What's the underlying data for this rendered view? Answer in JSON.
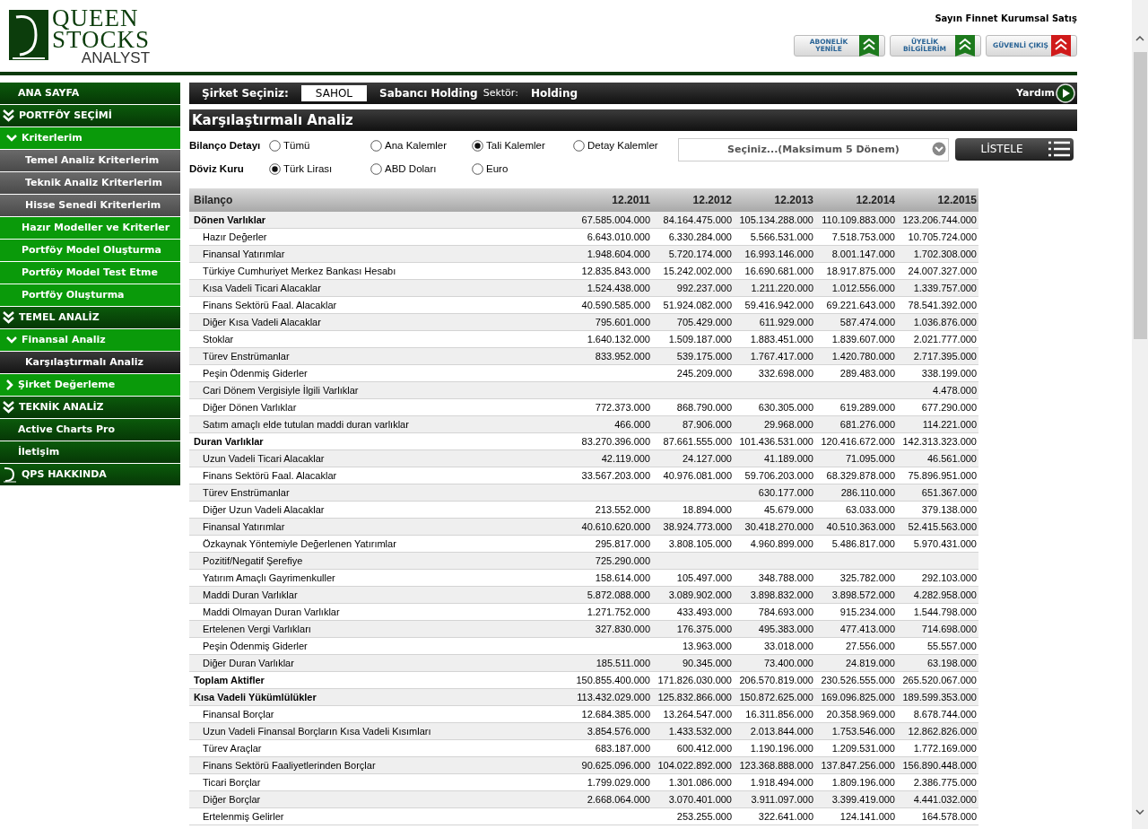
{
  "logo": {
    "lines": [
      "QUEEN",
      "STOCKS",
      "ANALYST"
    ]
  },
  "header": {
    "greeting": "Sayın Finnet Kurumsal Satış",
    "buttons": [
      {
        "label": "ABONELİK YENİLE",
        "kind": "green"
      },
      {
        "label": "ÜYELİK BİLGİLERİM",
        "kind": "green"
      },
      {
        "label": "GÜVENLİ ÇIKIŞ",
        "kind": "red"
      }
    ]
  },
  "sidebar": {
    "items": [
      {
        "label": "ANA SAYFA",
        "kind": "top",
        "selected": false
      },
      {
        "label": "PORTFÖY SEÇİMİ",
        "kind": "section",
        "expanded": true,
        "selected": false,
        "children": [
          {
            "label": "Kriterlerim",
            "kind": "group",
            "expanded": true,
            "selected": false,
            "children": [
              {
                "label": "Temel Analiz Kriterlerim",
                "kind": "leaf",
                "selected": false
              },
              {
                "label": "Teknik Analiz Kriterlerim",
                "kind": "leaf",
                "selected": false
              },
              {
                "label": "Hisse Senedi Kriterlerim",
                "kind": "leaf",
                "selected": false
              }
            ]
          },
          {
            "label": "Hazır Modeller ve Kriterler",
            "kind": "item",
            "selected": false
          },
          {
            "label": "Portföy Model Oluşturma",
            "kind": "item",
            "selected": false
          },
          {
            "label": "Portföy Model Test Etme",
            "kind": "item",
            "selected": false
          },
          {
            "label": "Portföy Oluşturma",
            "kind": "item",
            "selected": false
          }
        ]
      },
      {
        "label": "TEMEL ANALİZ",
        "kind": "section",
        "expanded": true,
        "selected": false,
        "children": [
          {
            "label": "Finansal Analiz",
            "kind": "group",
            "expanded": true,
            "selected": false,
            "children": [
              {
                "label": "Karşılaştırmalı Analiz",
                "kind": "leaf",
                "selected": true
              }
            ]
          },
          {
            "label": "Şirket Değerleme",
            "kind": "group",
            "expanded": false,
            "selected": false
          }
        ]
      },
      {
        "label": "TEKNİK ANALİZ",
        "kind": "section",
        "expanded": true,
        "selected": false
      },
      {
        "label": "Active Charts Pro",
        "kind": "top",
        "selected": false
      },
      {
        "label": "İletişim",
        "kind": "top",
        "selected": false
      },
      {
        "label": "QPS HAKKINDA",
        "kind": "about",
        "selected": false
      }
    ]
  },
  "company_bar": {
    "label": "Şirket Seçiniz:",
    "code": "SAHOL",
    "name": "Sabancı Holding",
    "sector_label": "Sektör:",
    "sector": "Holding",
    "help": "Yardım"
  },
  "page_title": "Karşılaştırmalı Analiz",
  "filters": [
    {
      "label": "Bilanço Detayı",
      "options": [
        {
          "label": "Tümü",
          "selected": false
        },
        {
          "label": "Ana Kalemler",
          "selected": false
        },
        {
          "label": "Tali Kalemler",
          "selected": true
        },
        {
          "label": "Detay Kalemler",
          "selected": false
        }
      ]
    },
    {
      "label": "Döviz Kuru",
      "options": [
        {
          "label": "Türk Lirası",
          "selected": true
        },
        {
          "label": "ABD Doları",
          "selected": false
        },
        {
          "label": "Euro",
          "selected": false
        }
      ]
    }
  ],
  "period_select": {
    "placeholder": "Seçiniz...(Maksimum 5 Dönem)"
  },
  "list_button": "LİSTELE",
  "table": {
    "columns": [
      "Bilanço",
      "12.2011",
      "12.2012",
      "12.2013",
      "12.2014",
      "12.2015"
    ],
    "rows": [
      {
        "kind": "total",
        "cells": [
          "Dönen Varlıklar",
          "67.585.004.000",
          "84.164.475.000",
          "105.134.288.000",
          "110.109.883.000",
          "123.206.744.000"
        ]
      },
      {
        "kind": "item",
        "cells": [
          "Hazır Değerler",
          "6.643.010.000",
          "6.330.284.000",
          "5.566.531.000",
          "7.518.753.000",
          "10.705.724.000"
        ]
      },
      {
        "kind": "item",
        "cells": [
          "Finansal Yatırımlar",
          "1.948.604.000",
          "5.720.174.000",
          "16.993.146.000",
          "8.001.147.000",
          "1.702.308.000"
        ]
      },
      {
        "kind": "item",
        "cells": [
          "Türkiye Cumhuriyet Merkez Bankası Hesabı",
          "12.835.843.000",
          "15.242.002.000",
          "16.690.681.000",
          "18.917.875.000",
          "24.007.327.000"
        ]
      },
      {
        "kind": "item",
        "cells": [
          "Kısa Vadeli Ticari Alacaklar",
          "1.524.438.000",
          "992.237.000",
          "1.211.220.000",
          "1.012.556.000",
          "1.339.757.000"
        ]
      },
      {
        "kind": "item",
        "cells": [
          "Finans Sektörü Faal. Alacaklar",
          "40.590.585.000",
          "51.924.082.000",
          "59.416.942.000",
          "69.221.643.000",
          "78.541.392.000"
        ]
      },
      {
        "kind": "item",
        "cells": [
          "Diğer Kısa Vadeli Alacaklar",
          "795.601.000",
          "705.429.000",
          "611.929.000",
          "587.474.000",
          "1.036.876.000"
        ]
      },
      {
        "kind": "item",
        "cells": [
          "Stoklar",
          "1.640.132.000",
          "1.509.187.000",
          "1.883.451.000",
          "1.839.607.000",
          "2.021.777.000"
        ]
      },
      {
        "kind": "item",
        "cells": [
          "Türev Enstrümanlar",
          "833.952.000",
          "539.175.000",
          "1.767.417.000",
          "1.420.780.000",
          "2.717.395.000"
        ]
      },
      {
        "kind": "item",
        "cells": [
          "Peşin Ödenmiş Giderler",
          "",
          "245.209.000",
          "332.698.000",
          "289.483.000",
          "338.199.000"
        ]
      },
      {
        "kind": "item",
        "cells": [
          "Cari Dönem Vergisiyle İlgili Varlıklar",
          "",
          "",
          "",
          "",
          "4.478.000"
        ]
      },
      {
        "kind": "item",
        "cells": [
          "Diğer Dönen Varlıklar",
          "772.373.000",
          "868.790.000",
          "630.305.000",
          "619.289.000",
          "677.290.000"
        ]
      },
      {
        "kind": "item",
        "cells": [
          "Satım amaçlı elde tutulan maddi duran varlıklar",
          "466.000",
          "87.906.000",
          "29.968.000",
          "681.276.000",
          "114.221.000"
        ]
      },
      {
        "kind": "total",
        "cells": [
          "Duran Varlıklar",
          "83.270.396.000",
          "87.661.555.000",
          "101.436.531.000",
          "120.416.672.000",
          "142.313.323.000"
        ]
      },
      {
        "kind": "item",
        "cells": [
          "Uzun Vadeli Ticari Alacaklar",
          "42.119.000",
          "24.127.000",
          "41.189.000",
          "71.095.000",
          "46.561.000"
        ]
      },
      {
        "kind": "item",
        "cells": [
          "Finans Sektörü Faal. Alacaklar",
          "33.567.203.000",
          "40.976.081.000",
          "59.706.203.000",
          "68.329.878.000",
          "75.896.951.000"
        ]
      },
      {
        "kind": "item",
        "cells": [
          "Türev Enstrümanlar",
          "",
          "",
          "630.177.000",
          "286.110.000",
          "651.367.000"
        ]
      },
      {
        "kind": "item",
        "cells": [
          "Diğer Uzun Vadeli Alacaklar",
          "213.552.000",
          "18.894.000",
          "45.679.000",
          "63.033.000",
          "379.138.000"
        ]
      },
      {
        "kind": "item",
        "cells": [
          "Finansal Yatırımlar",
          "40.610.620.000",
          "38.924.773.000",
          "30.418.270.000",
          "40.510.363.000",
          "52.415.563.000"
        ]
      },
      {
        "kind": "item",
        "cells": [
          "Özkaynak Yöntemiyle Değerlenen Yatırımlar",
          "295.817.000",
          "3.808.105.000",
          "4.960.899.000",
          "5.486.817.000",
          "5.970.431.000"
        ]
      },
      {
        "kind": "item",
        "cells": [
          "Pozitif/Negatif Şerefiye",
          "725.290.000",
          "",
          "",
          "",
          ""
        ]
      },
      {
        "kind": "item",
        "cells": [
          "Yatırım Amaçlı Gayrimenkuller",
          "158.614.000",
          "105.497.000",
          "348.788.000",
          "325.782.000",
          "292.103.000"
        ]
      },
      {
        "kind": "item",
        "cells": [
          "Maddi Duran Varlıklar",
          "5.872.088.000",
          "3.089.902.000",
          "3.898.832.000",
          "3.898.572.000",
          "4.282.958.000"
        ]
      },
      {
        "kind": "item",
        "cells": [
          "Maddi Olmayan Duran Varlıklar",
          "1.271.752.000",
          "433.493.000",
          "784.693.000",
          "915.234.000",
          "1.544.798.000"
        ]
      },
      {
        "kind": "item",
        "cells": [
          "Ertelenen Vergi Varlıkları",
          "327.830.000",
          "176.375.000",
          "495.383.000",
          "477.413.000",
          "714.698.000"
        ]
      },
      {
        "kind": "item",
        "cells": [
          "Peşin Ödenmiş Giderler",
          "",
          "13.963.000",
          "33.018.000",
          "27.556.000",
          "55.557.000"
        ]
      },
      {
        "kind": "item",
        "cells": [
          "Diğer Duran Varlıklar",
          "185.511.000",
          "90.345.000",
          "73.400.000",
          "24.819.000",
          "63.198.000"
        ]
      },
      {
        "kind": "total",
        "cells": [
          "Toplam Aktifler",
          "150.855.400.000",
          "171.826.030.000",
          "206.570.819.000",
          "230.526.555.000",
          "265.520.067.000"
        ]
      },
      {
        "kind": "total",
        "cells": [
          "Kısa Vadeli Yükümlülükler",
          "113.432.029.000",
          "125.832.866.000",
          "150.872.625.000",
          "169.096.825.000",
          "189.599.353.000"
        ]
      },
      {
        "kind": "item",
        "cells": [
          "Finansal Borçlar",
          "12.684.385.000",
          "13.264.547.000",
          "16.311.856.000",
          "20.358.969.000",
          "8.678.744.000"
        ]
      },
      {
        "kind": "item",
        "cells": [
          "Uzun Vadeli Finansal Borçların Kısa Vadeli Kısımları",
          "3.854.576.000",
          "1.433.532.000",
          "2.013.844.000",
          "1.753.546.000",
          "12.862.826.000"
        ]
      },
      {
        "kind": "item",
        "cells": [
          "Türev Araçlar",
          "683.187.000",
          "600.412.000",
          "1.190.196.000",
          "1.209.531.000",
          "1.772.169.000"
        ]
      },
      {
        "kind": "item",
        "cells": [
          "Finans Sektörü Faaliyetlerinden Borçlar",
          "90.625.096.000",
          "104.022.892.000",
          "123.368.888.000",
          "137.847.256.000",
          "156.890.448.000"
        ]
      },
      {
        "kind": "item",
        "cells": [
          "Ticari Borçlar",
          "1.799.029.000",
          "1.301.086.000",
          "1.918.494.000",
          "1.809.196.000",
          "2.386.775.000"
        ]
      },
      {
        "kind": "item",
        "cells": [
          "Diğer Borçlar",
          "2.668.064.000",
          "3.070.401.000",
          "3.911.097.000",
          "3.399.419.000",
          "4.441.032.000"
        ]
      },
      {
        "kind": "item",
        "cells": [
          "Ertelenmiş Gelirler",
          "",
          "253.255.000",
          "322.641.000",
          "124.141.000",
          "164.578.000"
        ]
      }
    ]
  }
}
